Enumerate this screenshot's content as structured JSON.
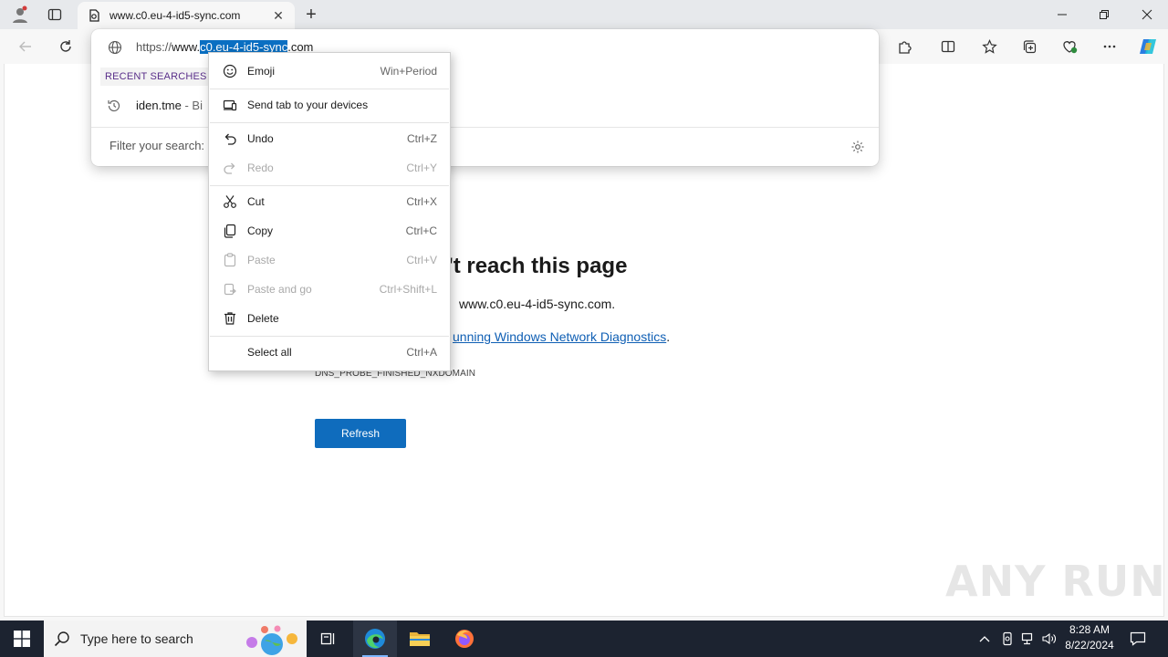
{
  "browser": {
    "tab_title": "www.c0.eu-4-id5-sync.com",
    "address": {
      "prefix": "https://",
      "before_selection": "www.",
      "selection": "c0.eu-4-id5-sync",
      "after_selection": ".com"
    }
  },
  "omnibox": {
    "recent_label": "RECENT SEARCHES",
    "recent_item": "iden.tme",
    "recent_item_suffix": " - Bi",
    "filter_placeholder": "Filter your search:"
  },
  "context_menu": {
    "items": [
      {
        "label": "Emoji",
        "shortcut": "Win+Period"
      },
      {
        "label": "Send tab to your devices",
        "shortcut": ""
      },
      {
        "label": "Undo",
        "shortcut": "Ctrl+Z"
      },
      {
        "label": "Redo",
        "shortcut": "Ctrl+Y"
      },
      {
        "label": "Cut",
        "shortcut": "Ctrl+X"
      },
      {
        "label": "Copy",
        "shortcut": "Ctrl+C"
      },
      {
        "label": "Paste",
        "shortcut": "Ctrl+V"
      },
      {
        "label": "Paste and go",
        "shortcut": "Ctrl+Shift+L"
      },
      {
        "label": "Delete",
        "shortcut": ""
      },
      {
        "label": "Select all",
        "shortcut": "Ctrl+A"
      }
    ]
  },
  "error_page": {
    "title_visible": "'t reach this page",
    "line1_visible": "www.c0.eu-4-id5-sync.com.",
    "line2_link": "unning Windows Network Diagnostics",
    "line2_end": ".",
    "code": "DNS_PROBE_FINISHED_NXDOMAIN",
    "refresh_label": "Refresh"
  },
  "watermark": "ANY RUN",
  "taskbar": {
    "search_placeholder": "Type here to search",
    "time": "8:28 AM",
    "date": "8/22/2024"
  },
  "colors": {
    "accent": "#0f6cbd",
    "selection": "#0a6fc2",
    "link": "#0f5fb4",
    "taskbar": "#1c2330"
  }
}
